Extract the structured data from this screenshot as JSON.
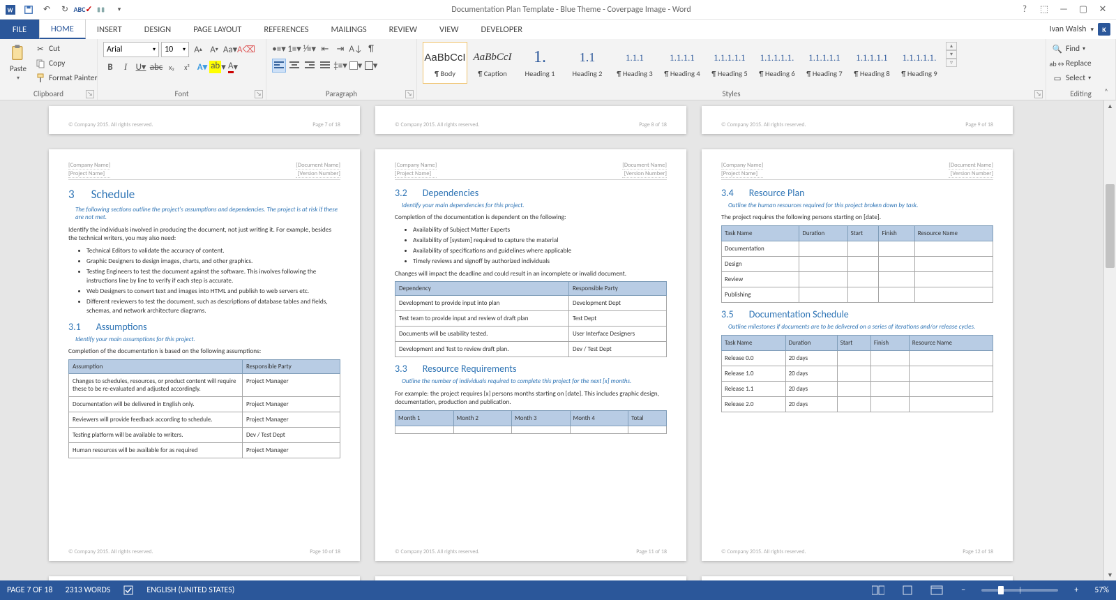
{
  "title": "Documentation Plan Template - Blue Theme - Coverpage Image - Word",
  "user": {
    "name": "Ivan Walsh",
    "initial": "K"
  },
  "tabs": [
    "FILE",
    "HOME",
    "INSERT",
    "DESIGN",
    "PAGE LAYOUT",
    "REFERENCES",
    "MAILINGS",
    "REVIEW",
    "VIEW",
    "DEVELOPER"
  ],
  "activeTab": "HOME",
  "ribbon": {
    "clipboard": {
      "label": "Clipboard",
      "paste": "Paste",
      "cut": "Cut",
      "copy": "Copy",
      "formatPainter": "Format Painter"
    },
    "font": {
      "label": "Font",
      "name": "Arial",
      "size": "10"
    },
    "paragraph": {
      "label": "Paragraph"
    },
    "styles": {
      "label": "Styles",
      "items": [
        {
          "preview": "AaBbCcI",
          "name": "¶ Body",
          "cls": "body"
        },
        {
          "preview": "AaBbCcI",
          "name": "¶ Caption",
          "cls": "italic"
        },
        {
          "preview": "1.",
          "name": "Heading 1",
          "cls": ""
        },
        {
          "preview": "1.1",
          "name": "Heading 2",
          "cls": ""
        },
        {
          "preview": "1.1.1",
          "name": "¶ Heading 3",
          "cls": ""
        },
        {
          "preview": "1.1.1.1",
          "name": "¶ Heading 4",
          "cls": ""
        },
        {
          "preview": "1.1.1.1.1",
          "name": "¶ Heading 5",
          "cls": ""
        },
        {
          "preview": "1.1.1.1.1.",
          "name": "¶ Heading 6",
          "cls": ""
        },
        {
          "preview": "1.1.1.1.1",
          "name": "¶ Heading 7",
          "cls": ""
        },
        {
          "preview": "1.1.1.1.1",
          "name": "¶ Heading 8",
          "cls": ""
        },
        {
          "preview": "1.1.1.1.1.",
          "name": "¶ Heading 9",
          "cls": ""
        }
      ]
    },
    "editing": {
      "label": "Editing",
      "find": "Find",
      "replace": "Replace",
      "select": "Select"
    }
  },
  "docHeader": {
    "leftTop": "[Company Name]",
    "leftBot": "[Project Name]",
    "rightTop": "[Document Name]",
    "rightBot": "[Version Number]"
  },
  "footerNote": "© Company 2015. All rights reserved.",
  "page7footer": "Page 7 of 18",
  "page8footer": "Page 8 of 18",
  "page9footer": "Page 9 of 18",
  "page10footer": "Page 10 of 18",
  "page11footer": "Page 11 of 18",
  "page12footer": "Page 12 of 18",
  "p10": {
    "h1num": "3",
    "h1": "Schedule",
    "intro": "The following sections outline the project's assumptions and dependencies. The project is at risk if these are not met.",
    "body1": "Identify the individuals involved in producing the document, not just writing it. For example, besides the technical writers, you may also need:",
    "bul": [
      "Technical Editors to validate the accuracy of content.",
      "Graphic Designers to design images, charts, and other graphics.",
      "Testing Engineers to test the document against the software. This involves following the instructions line by line to verify if each step is accurate.",
      "Web Designers to convert text and images into HTML and publish to web servers etc.",
      "Different reviewers to test the document, such as descriptions of database tables and fields, schemas, and network architecture diagrams."
    ],
    "h2num": "3.1",
    "h2": "Assumptions",
    "h2intro": "Identify your main assumptions for this project.",
    "body2": "Completion of the documentation is based on the following assumptions:",
    "table": {
      "head": [
        "Assumption",
        "Responsible Party"
      ],
      "rows": [
        [
          "Changes to schedules, resources, or product content will require these to be re-evaluated and adjusted accordingly.",
          "Project Manager"
        ],
        [
          "Documentation will be delivered in English only.",
          "Project Manager"
        ],
        [
          "Reviewers will provide feedback according to schedule.",
          "Project Manager"
        ],
        [
          "Testing platform will be available to writers.",
          "Dev / Test Dept"
        ],
        [
          "Human resources will be available for as required",
          "Project Manager"
        ]
      ]
    }
  },
  "p11": {
    "h2anum": "3.2",
    "h2a": "Dependencies",
    "h2aintro": "Identify your main dependencies for this project.",
    "body1": "Completion of the documentation is dependent on the following:",
    "bul": [
      "Availability of Subject Matter Experts",
      "Availability of [system] required to capture the material",
      "Availability of specifications and guidelines where applicable",
      "Timely reviews and signoff by authorized individuals"
    ],
    "body2": "Changes will impact the deadline and could result in an incomplete or invalid document.",
    "tableA": {
      "head": [
        "Dependency",
        "Responsible Party"
      ],
      "rows": [
        [
          "Development to provide input into plan",
          "Development Dept"
        ],
        [
          "Test team to provide input and review of draft plan",
          "Test Dept"
        ],
        [
          "Documents will be usability tested.",
          "User Interface Designers"
        ],
        [
          "Development and Test to review draft plan.",
          "Dev / Test Dept"
        ]
      ]
    },
    "h2bnum": "3.3",
    "h2b": "Resource Requirements",
    "h2bintro": "Outline the number of individuals required to complete this project for the next [x] months.",
    "body3": "For example: the project requires [x] persons months starting on [date]. This includes graphic design, documentation, production and publication.",
    "tableB": {
      "head": [
        "Month 1",
        "Month 2",
        "Month 3",
        "Month 4",
        "Total"
      ],
      "rows": [
        [
          "",
          "",
          "",
          "",
          ""
        ]
      ]
    }
  },
  "p12": {
    "h2anum": "3.4",
    "h2a": "Resource Plan",
    "h2aintro": "Outline the human resources required for this project broken down by task.",
    "body1": "The project requires the following persons starting on [date].",
    "tableA": {
      "head": [
        "Task Name",
        "Duration",
        "Start",
        "Finish",
        "Resource Name"
      ],
      "rows": [
        [
          "Documentation",
          "",
          "",
          "",
          ""
        ],
        [
          "Design",
          "",
          "",
          "",
          ""
        ],
        [
          "Review",
          "",
          "",
          "",
          ""
        ],
        [
          "Publishing",
          "",
          "",
          "",
          ""
        ]
      ]
    },
    "h2bnum": "3.5",
    "h2b": "Documentation Schedule",
    "h2bintro": "Outline milestones if documents are to be delivered on a series of iterations and/or release cycles.",
    "tableB": {
      "head": [
        "Task Name",
        "Duration",
        "Start",
        "Finish",
        "Resource Name"
      ],
      "rows": [
        [
          "Release 0.0",
          "20 days",
          "",
          "",
          ""
        ],
        [
          "Release 1.0",
          "20 days",
          "",
          "",
          ""
        ],
        [
          "Release 1.1",
          "20 days",
          "",
          "",
          ""
        ],
        [
          "Release 2.0",
          "20 days",
          "",
          "",
          ""
        ]
      ]
    }
  },
  "status": {
    "page": "PAGE 7 OF 18",
    "words": "2313 WORDS",
    "lang": "ENGLISH (UNITED STATES)",
    "zoom": "57%"
  }
}
